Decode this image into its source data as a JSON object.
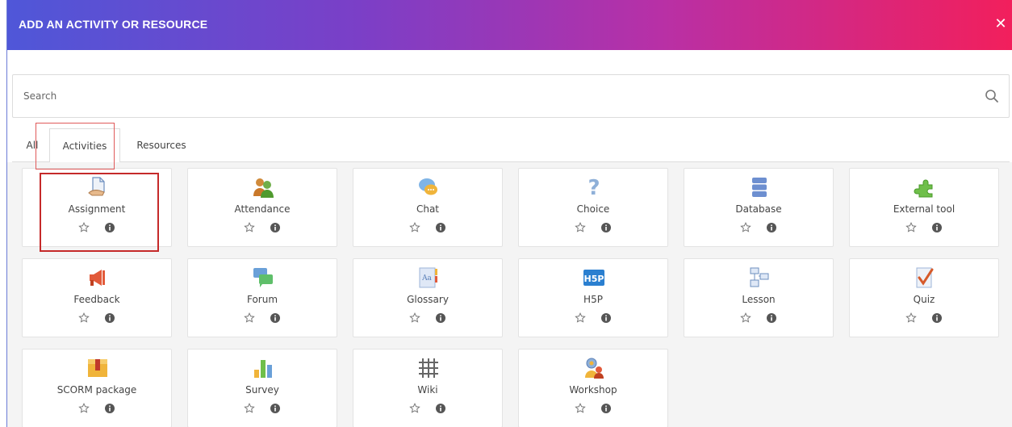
{
  "header": {
    "title": "ADD AN ACTIVITY OR RESOURCE",
    "close_glyph": "✕"
  },
  "search": {
    "placeholder": "Search",
    "value": ""
  },
  "tabs": [
    {
      "label": "All"
    },
    {
      "label": "Activities"
    },
    {
      "label": "Resources"
    }
  ],
  "active_tab": "Activities",
  "activities": [
    {
      "label": "Assignment",
      "icon": "assignment-icon"
    },
    {
      "label": "Attendance",
      "icon": "attendance-icon"
    },
    {
      "label": "Chat",
      "icon": "chat-icon"
    },
    {
      "label": "Choice",
      "icon": "choice-icon"
    },
    {
      "label": "Database",
      "icon": "database-icon"
    },
    {
      "label": "External tool",
      "icon": "external-tool-icon"
    },
    {
      "label": "Feedback",
      "icon": "feedback-icon"
    },
    {
      "label": "Forum",
      "icon": "forum-icon"
    },
    {
      "label": "Glossary",
      "icon": "glossary-icon"
    },
    {
      "label": "H5P",
      "icon": "h5p-icon"
    },
    {
      "label": "Lesson",
      "icon": "lesson-icon"
    },
    {
      "label": "Quiz",
      "icon": "quiz-icon"
    },
    {
      "label": "SCORM package",
      "icon": "scorm-package-icon"
    },
    {
      "label": "Survey",
      "icon": "survey-icon"
    },
    {
      "label": "Wiki",
      "icon": "wiki-icon"
    },
    {
      "label": "Workshop",
      "icon": "workshop-icon"
    }
  ],
  "colors": {
    "header_start": "#4f57d8",
    "header_end": "#f21f5c",
    "highlight": "#c52a2a"
  }
}
